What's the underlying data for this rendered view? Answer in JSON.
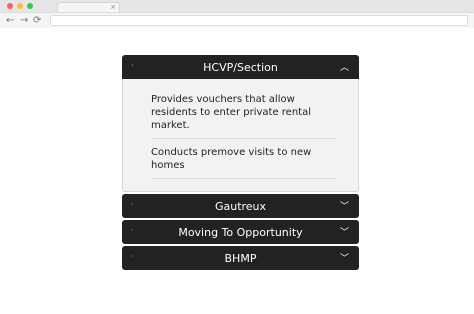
{
  "browser": {
    "tab_close": "×",
    "back_icon": "←",
    "forward_icon": "→",
    "reload_icon": "⟳"
  },
  "accordion": {
    "sections": [
      {
        "title": "HCVP/Section",
        "expanded": true,
        "items": [
          "Provides vouchers that allow residents to enter private rental market.",
          "Conducts premove visits to new homes"
        ]
      },
      {
        "title": "Gautreux",
        "expanded": false
      },
      {
        "title": "Moving To Opportunity",
        "expanded": false
      },
      {
        "title": "BHMP",
        "expanded": false
      }
    ],
    "colors": {
      "header_bg": "#222222",
      "panel_bg": "#f2f2f2"
    }
  }
}
